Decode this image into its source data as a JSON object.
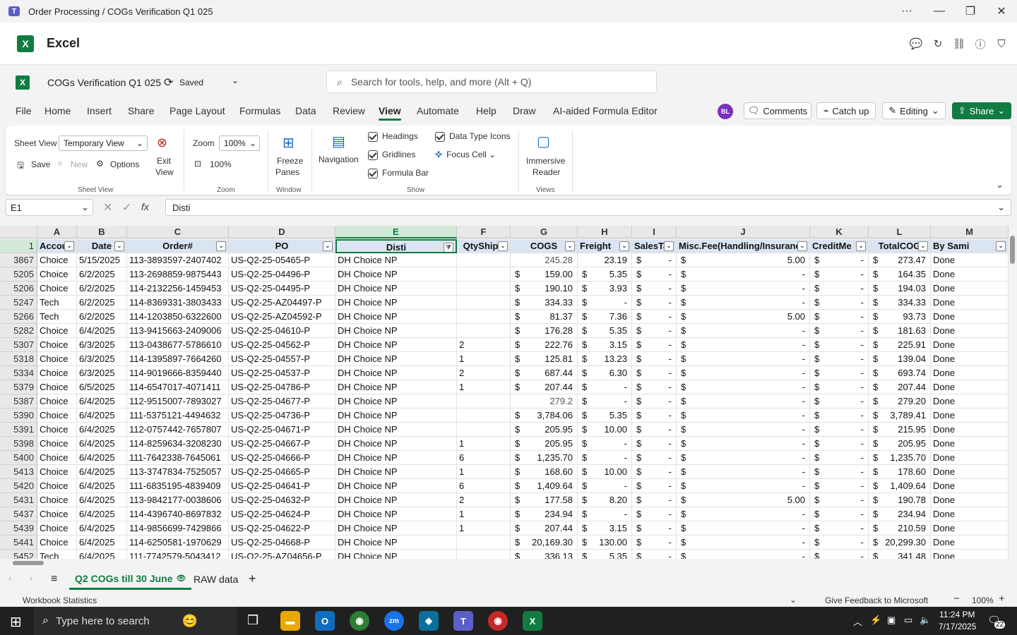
{
  "window": {
    "title": "Order Processing / COGs Verification Q1 025"
  },
  "app": {
    "name": "Excel"
  },
  "doc": {
    "title": "COGs Verification Q1 025",
    "saved": "Saved"
  },
  "search": {
    "placeholder": "Search for tools, help, and more (Alt + Q)"
  },
  "menu": [
    "File",
    "Home",
    "Insert",
    "Share",
    "Page Layout",
    "Formulas",
    "Data",
    "Review",
    "View",
    "Automate",
    "Help",
    "Draw",
    "AI-aided Formula Editor"
  ],
  "active_menu": "View",
  "user_initials": "BL",
  "buttons": {
    "comments": "Comments",
    "catchup": "Catch up",
    "editing": "Editing",
    "share": "Share"
  },
  "ribbon": {
    "sheet_view_label": "Sheet View",
    "sheet_view_value": "Temporary View",
    "exit_view": [
      "Exit",
      "View"
    ],
    "save": "Save",
    "new": "New",
    "options": "Options",
    "group_sheetview": "Sheet View",
    "zoom_label": "Zoom",
    "zoom_value": "100%",
    "zoom_100": "100%",
    "group_zoom": "Zoom",
    "freeze": [
      "Freeze",
      "Panes"
    ],
    "group_window": "Window",
    "navigation": "Navigation",
    "headings": "Headings",
    "gridlines": "Gridlines",
    "formula_bar": "Formula Bar",
    "data_type_icons": "Data Type Icons",
    "focus_cell": "Focus Cell",
    "group_show": "Show",
    "immersive": [
      "Immersive",
      "Reader"
    ],
    "group_views": "Views"
  },
  "formula": {
    "namebox": "E1",
    "content": "Disti"
  },
  "columns": [
    "A",
    "B",
    "C",
    "D",
    "E",
    "F",
    "G",
    "H",
    "I",
    "J",
    "K",
    "L",
    "M"
  ],
  "header_row": {
    "num": "1",
    "cells": [
      "Accou",
      "Date",
      "Order#",
      "PO",
      "Disti",
      "QtyShipp",
      "COGS",
      "Freight",
      "SalesTa",
      "Misc.Fee(Handling/Insuranc",
      "CreditMe",
      "TotalCOG",
      "By Sami"
    ]
  },
  "rows": [
    {
      "n": "3867",
      "a": "Choice",
      "b": "5/15/2025",
      "c": "113-3893597-2407402",
      "d": "US-Q2-25-05465-P",
      "e": "DH Choice NP",
      "f": "",
      "g_cur": "",
      "g": "245.28",
      "h_cur": "",
      "h": "23.19",
      "i": "-",
      "j": "5.00",
      "k": "-",
      "l": "273.47",
      "m": "Done"
    },
    {
      "n": "5205",
      "a": "Choice",
      "b": "6/2/2025",
      "c": "113-2698859-9875443",
      "d": "US-Q2-25-04496-P",
      "e": "DH Choice NP",
      "f": "",
      "g_cur": "$",
      "g": "159.00",
      "h_cur": "$",
      "h": "5.35",
      "i": "-",
      "j": "-",
      "k": "-",
      "l": "164.35",
      "m": "Done"
    },
    {
      "n": "5206",
      "a": "Choice",
      "b": "6/2/2025",
      "c": "114-2132256-1459453",
      "d": "US-Q2-25-04495-P",
      "e": "DH Choice NP",
      "f": "",
      "g_cur": "$",
      "g": "190.10",
      "h_cur": "$",
      "h": "3.93",
      "i": "-",
      "j": "-",
      "k": "-",
      "l": "194.03",
      "m": "Done"
    },
    {
      "n": "5247",
      "a": "Tech",
      "b": "6/2/2025",
      "c": "114-8369331-3803433",
      "d": "US-Q2-25-AZ04497-P",
      "e": "DH Choice NP",
      "f": "",
      "g_cur": "$",
      "g": "334.33",
      "h_cur": "$",
      "h": "-",
      "i": "-",
      "j": "-",
      "k": "-",
      "l": "334.33",
      "m": "Done"
    },
    {
      "n": "5266",
      "a": "Tech",
      "b": "6/2/2025",
      "c": "114-1203850-6322600",
      "d": "US-Q2-25-AZ04592-P",
      "e": "DH Choice NP",
      "f": "",
      "g_cur": "$",
      "g": "81.37",
      "h_cur": "$",
      "h": "7.36",
      "i": "-",
      "j": "5.00",
      "k": "-",
      "l": "93.73",
      "m": "Done"
    },
    {
      "n": "5282",
      "a": "Choice",
      "b": "6/4/2025",
      "c": "113-9415663-2409006",
      "d": "US-Q2-25-04610-P",
      "e": "DH Choice NP",
      "f": "",
      "g_cur": "$",
      "g": "176.28",
      "h_cur": "$",
      "h": "5.35",
      "i": "-",
      "j": "-",
      "k": "-",
      "l": "181.63",
      "m": "Done"
    },
    {
      "n": "5307",
      "a": "Choice",
      "b": "6/3/2025",
      "c": "113-0438677-5786610",
      "d": "US-Q2-25-04562-P",
      "e": "DH Choice NP",
      "f": "2",
      "g_cur": "$",
      "g": "222.76",
      "h_cur": "$",
      "h": "3.15",
      "i": "-",
      "j": "-",
      "k": "-",
      "l": "225.91",
      "m": "Done"
    },
    {
      "n": "5318",
      "a": "Choice",
      "b": "6/3/2025",
      "c": "114-1395897-7664260",
      "d": "US-Q2-25-04557-P",
      "e": "DH Choice NP",
      "f": "1",
      "g_cur": "$",
      "g": "125.81",
      "h_cur": "$",
      "h": "13.23",
      "i": "-",
      "j": "-",
      "k": "-",
      "l": "139.04",
      "m": "Done"
    },
    {
      "n": "5334",
      "a": "Choice",
      "b": "6/3/2025",
      "c": "114-9019666-8359440",
      "d": "US-Q2-25-04537-P",
      "e": "DH Choice NP",
      "f": "2",
      "g_cur": "$",
      "g": "687.44",
      "h_cur": "$",
      "h": "6.30",
      "i": "-",
      "j": "-",
      "k": "-",
      "l": "693.74",
      "m": "Done"
    },
    {
      "n": "5379",
      "a": "Choice",
      "b": "6/5/2025",
      "c": "114-6547017-4071411",
      "d": "US-Q2-25-04786-P",
      "e": "DH Choice NP",
      "f": "1",
      "g_cur": "$",
      "g": "207.44",
      "h_cur": "$",
      "h": "-",
      "i": "-",
      "j": "-",
      "k": "-",
      "l": "207.44",
      "m": "Done"
    },
    {
      "n": "5387",
      "a": "Choice",
      "b": "6/4/2025",
      "c": "112-9515007-7893027",
      "d": "US-Q2-25-04677-P",
      "e": "DH Choice NP",
      "f": "",
      "g_cur": "",
      "g": "279.2",
      "h_cur": "$",
      "h": "-",
      "i": "-",
      "j": "-",
      "k": "-",
      "l": "279.20",
      "m": "Done"
    },
    {
      "n": "5390",
      "a": "Choice",
      "b": "6/4/2025",
      "c": "111-5375121-4494632",
      "d": "US-Q2-25-04736-P",
      "e": "DH Choice NP",
      "f": "",
      "g_cur": "$",
      "g": "3,784.06",
      "h_cur": "$",
      "h": "5.35",
      "i": "-",
      "j": "-",
      "k": "-",
      "l": "3,789.41",
      "m": "Done"
    },
    {
      "n": "5391",
      "a": "Choice",
      "b": "6/4/2025",
      "c": "112-0757442-7657807",
      "d": "US-Q2-25-04671-P",
      "e": "DH Choice NP",
      "f": "",
      "g_cur": "$",
      "g": "205.95",
      "h_cur": "$",
      "h": "10.00",
      "i": "-",
      "j": "-",
      "k": "-",
      "l": "215.95",
      "m": "Done"
    },
    {
      "n": "5398",
      "a": "Choice",
      "b": "6/4/2025",
      "c": "114-8259634-3208230",
      "d": "US-Q2-25-04667-P",
      "e": "DH Choice NP",
      "f": "1",
      "g_cur": "$",
      "g": "205.95",
      "h_cur": "$",
      "h": "-",
      "i": "-",
      "j": "-",
      "k": "-",
      "l": "205.95",
      "m": "Done"
    },
    {
      "n": "5400",
      "a": "Choice",
      "b": "6/4/2025",
      "c": "111-7642338-7645061",
      "d": "US-Q2-25-04666-P",
      "e": "DH Choice NP",
      "f": "6",
      "g_cur": "$",
      "g": "1,235.70",
      "h_cur": "$",
      "h": "-",
      "i": "-",
      "j": "-",
      "k": "-",
      "l": "1,235.70",
      "m": "Done"
    },
    {
      "n": "5413",
      "a": "Choice",
      "b": "6/4/2025",
      "c": "113-3747834-7525057",
      "d": "US-Q2-25-04665-P",
      "e": "DH Choice NP",
      "f": "1",
      "g_cur": "$",
      "g": "168.60",
      "h_cur": "$",
      "h": "10.00",
      "i": "-",
      "j": "-",
      "k": "-",
      "l": "178.60",
      "m": "Done"
    },
    {
      "n": "5420",
      "a": "Choice",
      "b": "6/4/2025",
      "c": "111-6835195-4839409",
      "d": "US-Q2-25-04641-P",
      "e": "DH Choice NP",
      "f": "6",
      "g_cur": "$",
      "g": "1,409.64",
      "h_cur": "$",
      "h": "-",
      "i": "-",
      "j": "-",
      "k": "-",
      "l": "1,409.64",
      "m": "Done"
    },
    {
      "n": "5431",
      "a": "Choice",
      "b": "6/4/2025",
      "c": "113-9842177-0038606",
      "d": "US-Q2-25-04632-P",
      "e": "DH Choice NP",
      "f": "2",
      "g_cur": "$",
      "g": "177.58",
      "h_cur": "$",
      "h": "8.20",
      "i": "-",
      "j": "5.00",
      "k": "-",
      "l": "190.78",
      "m": "Done"
    },
    {
      "n": "5437",
      "a": "Choice",
      "b": "6/4/2025",
      "c": "114-4396740-8697832",
      "d": "US-Q2-25-04624-P",
      "e": "DH Choice NP",
      "f": "1",
      "g_cur": "$",
      "g": "234.94",
      "h_cur": "$",
      "h": "-",
      "i": "-",
      "j": "-",
      "k": "-",
      "l": "234.94",
      "m": "Done"
    },
    {
      "n": "5439",
      "a": "Choice",
      "b": "6/4/2025",
      "c": "114-9856699-7429866",
      "d": "US-Q2-25-04622-P",
      "e": "DH Choice NP",
      "f": "1",
      "g_cur": "$",
      "g": "207.44",
      "h_cur": "$",
      "h": "3.15",
      "i": "-",
      "j": "-",
      "k": "-",
      "l": "210.59",
      "m": "Done"
    },
    {
      "n": "5441",
      "a": "Choice",
      "b": "6/4/2025",
      "c": "114-6250581-1970629",
      "d": "US-Q2-25-04668-P",
      "e": "DH Choice NP",
      "f": "",
      "g_cur": "$",
      "g": "20,169.30",
      "h_cur": "$",
      "h": "130.00",
      "i": "-",
      "j": "-",
      "k": "-",
      "l": "20,299.30",
      "m": "Done"
    },
    {
      "n": "5452",
      "a": "Tech",
      "b": "6/4/2025",
      "c": "111-7742579-5043412",
      "d": "US-Q2-25-AZ04656-P",
      "e": "DH Choice NP",
      "f": "",
      "g_cur": "$",
      "g": "336.13",
      "h_cur": "$",
      "h": "5.35",
      "i": "-",
      "j": "-",
      "k": "-",
      "l": "341.48",
      "m": "Done"
    }
  ],
  "sheets": [
    "Q2 COGs till 30 June",
    "RAW data"
  ],
  "status": {
    "left": "Workbook Statistics",
    "feedback": "Give Feedback to Microsoft",
    "zoom": "100%"
  },
  "taskbar": {
    "search": "Type here to search",
    "time": "11:24 PM",
    "date": "7/17/2025",
    "notif": "22"
  }
}
